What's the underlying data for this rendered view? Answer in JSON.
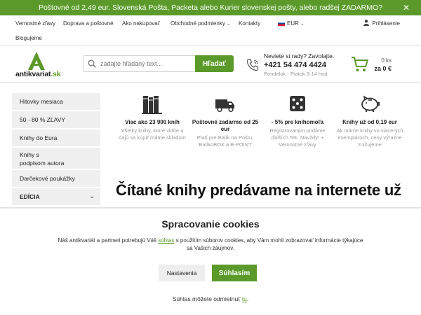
{
  "topbar": {
    "message": "Poštovné od 2,49 eur. Slovenská Pošta, Packeta alebo Kurier slovenskej pošty, alebo radšej ZADARMO?",
    "close_icon": "close-icon"
  },
  "nav": {
    "items": [
      {
        "label": "Vernostné zľavy"
      },
      {
        "label": "Doprava a poštovné"
      },
      {
        "label": "Ako nakupovať"
      },
      {
        "label": "Obchodné podmienky"
      },
      {
        "label": "Kontakty"
      },
      {
        "label": "EUR"
      }
    ],
    "second_row": "Blogujeme",
    "login": "Prihlásenie"
  },
  "header": {
    "logo_text": "antikvariat",
    "logo_tld": ".sk",
    "search_placeholder": "zadajte hľadaný text...",
    "search_button": "Hľadať",
    "contact_line1": "Neviete si rady? Zavolajte.",
    "contact_phone": "+421 54 474 4424",
    "contact_hours": "Pondelok - Piatok 8-14 hod.",
    "cart_count": "0 ks",
    "cart_total": "za 0 €"
  },
  "sidebar": {
    "items": [
      {
        "label": "Hitovky mesiaca"
      },
      {
        "label": "50 - 80 % ZĽAVY"
      },
      {
        "label": "Knihy do Eura"
      },
      {
        "label": "Knihy s podpisom autora"
      },
      {
        "label": "Darčekové poukážky"
      },
      {
        "label": "EDÍCIA"
      }
    ]
  },
  "features": [
    {
      "icon": "books-icon",
      "title": "Viac ako 23 900 kníh",
      "desc": "Všetky knihy, ktoré vidíte a dajú sa kúpiť máme skladom"
    },
    {
      "icon": "truck-icon",
      "title": "Poštovné zadarmo od 25 eur",
      "desc": "Platí pre Balík na Poštu, BalíkoBOX a B-POINT"
    },
    {
      "icon": "dice-icon",
      "title": "- 5% pre knihomoľa",
      "desc": "Registrovaným pridáme ďalších 5%. Navždy! + Vernostné zľavy"
    },
    {
      "icon": "piggy-bank-icon",
      "title": "Knihy už od 0,19 eur",
      "desc": "Ak máme knihy vo viacerých exemplároch, ceny výrazne znižujeme"
    }
  ],
  "headline": "Čítané knihy predávame na internete už",
  "cookie": {
    "title": "Spracovanie cookies",
    "text_before": "Náš antikvariát a partneri potrebujú Váš ",
    "text_link": "súhlas",
    "text_after": " s použitím súborov cookies, aby Vám mohli zobrazovať informácie týkajúce sa Vašich záujmov.",
    "settings_button": "Nastavenia",
    "accept_button": "Súhlasím",
    "withdraw_before": "Súhlas môžete odmietnuť ",
    "withdraw_link": "tu",
    "withdraw_after": "."
  },
  "colors": {
    "accent": "#5b9a2a"
  }
}
